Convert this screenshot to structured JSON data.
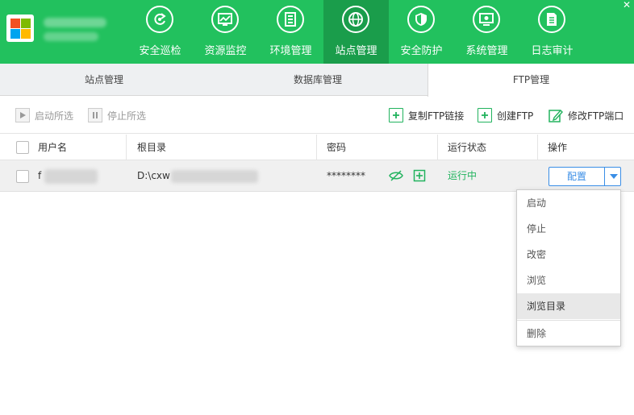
{
  "app": {
    "close_symbol": "✕"
  },
  "nav": {
    "items": [
      {
        "label": "安全巡检",
        "icon": "refresh-icon"
      },
      {
        "label": "资源监控",
        "icon": "chart-icon"
      },
      {
        "label": "环境管理",
        "icon": "server-icon"
      },
      {
        "label": "站点管理",
        "icon": "globe-icon",
        "active": true
      },
      {
        "label": "安全防护",
        "icon": "shield-icon"
      },
      {
        "label": "系统管理",
        "icon": "monitor-icon"
      },
      {
        "label": "日志审计",
        "icon": "document-icon"
      }
    ]
  },
  "tabs": [
    "站点管理",
    "数据库管理",
    "FTP管理"
  ],
  "toolbar": {
    "start_selected": "启动所选",
    "stop_selected": "停止所选",
    "copy_ftp_link": "复制FTP链接",
    "create_ftp": "创建FTP",
    "modify_ftp_port": "修改FTP端口"
  },
  "table": {
    "columns": [
      "用户名",
      "根目录",
      "密码",
      "运行状态",
      "操作"
    ],
    "rows": [
      {
        "username_prefix": "f",
        "root_prefix": "D:\\cxw",
        "password": "********",
        "status": "运行中",
        "action": "配置"
      }
    ]
  },
  "menu": {
    "items": [
      "启动",
      "停止",
      "改密",
      "浏览",
      "浏览目录",
      "删除"
    ],
    "highlighted": "浏览目录"
  },
  "colors": {
    "brand_green": "#22c15e",
    "active_nav": "#1a9d4b",
    "status_green": "#22b35e",
    "button_blue": "#3a8ee6"
  }
}
